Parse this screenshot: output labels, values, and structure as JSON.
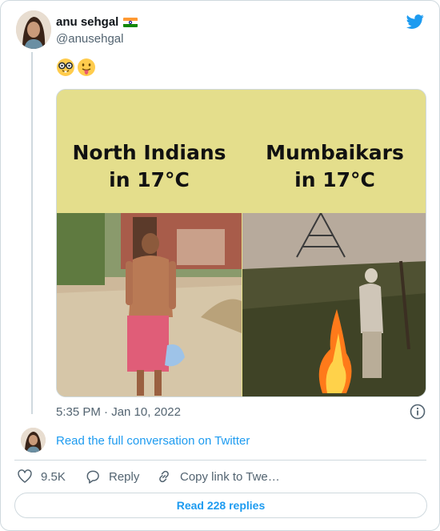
{
  "tweet": {
    "author": {
      "name": "anu sehgal",
      "flag_icon": "india-flag-icon",
      "handle": "@anusehgal"
    },
    "brand_icon": "twitter-bird-icon",
    "brand_color": "#1d9bf0",
    "emojis": [
      "nerd-face-emoji",
      "tongue-out-emoji"
    ],
    "media": {
      "caption_left": "North Indians\nin 17°C",
      "caption_right": "Mumbaikars\nin 17°C"
    },
    "timestamp": "5:35 PM · Jan 10, 2022"
  },
  "conversation_link": "Read the full conversation on Twitter",
  "actions": {
    "like_count": "9.5K",
    "reply_label": "Reply",
    "copy_label": "Copy link to Twe…"
  },
  "replies_button": "Read 228 replies"
}
